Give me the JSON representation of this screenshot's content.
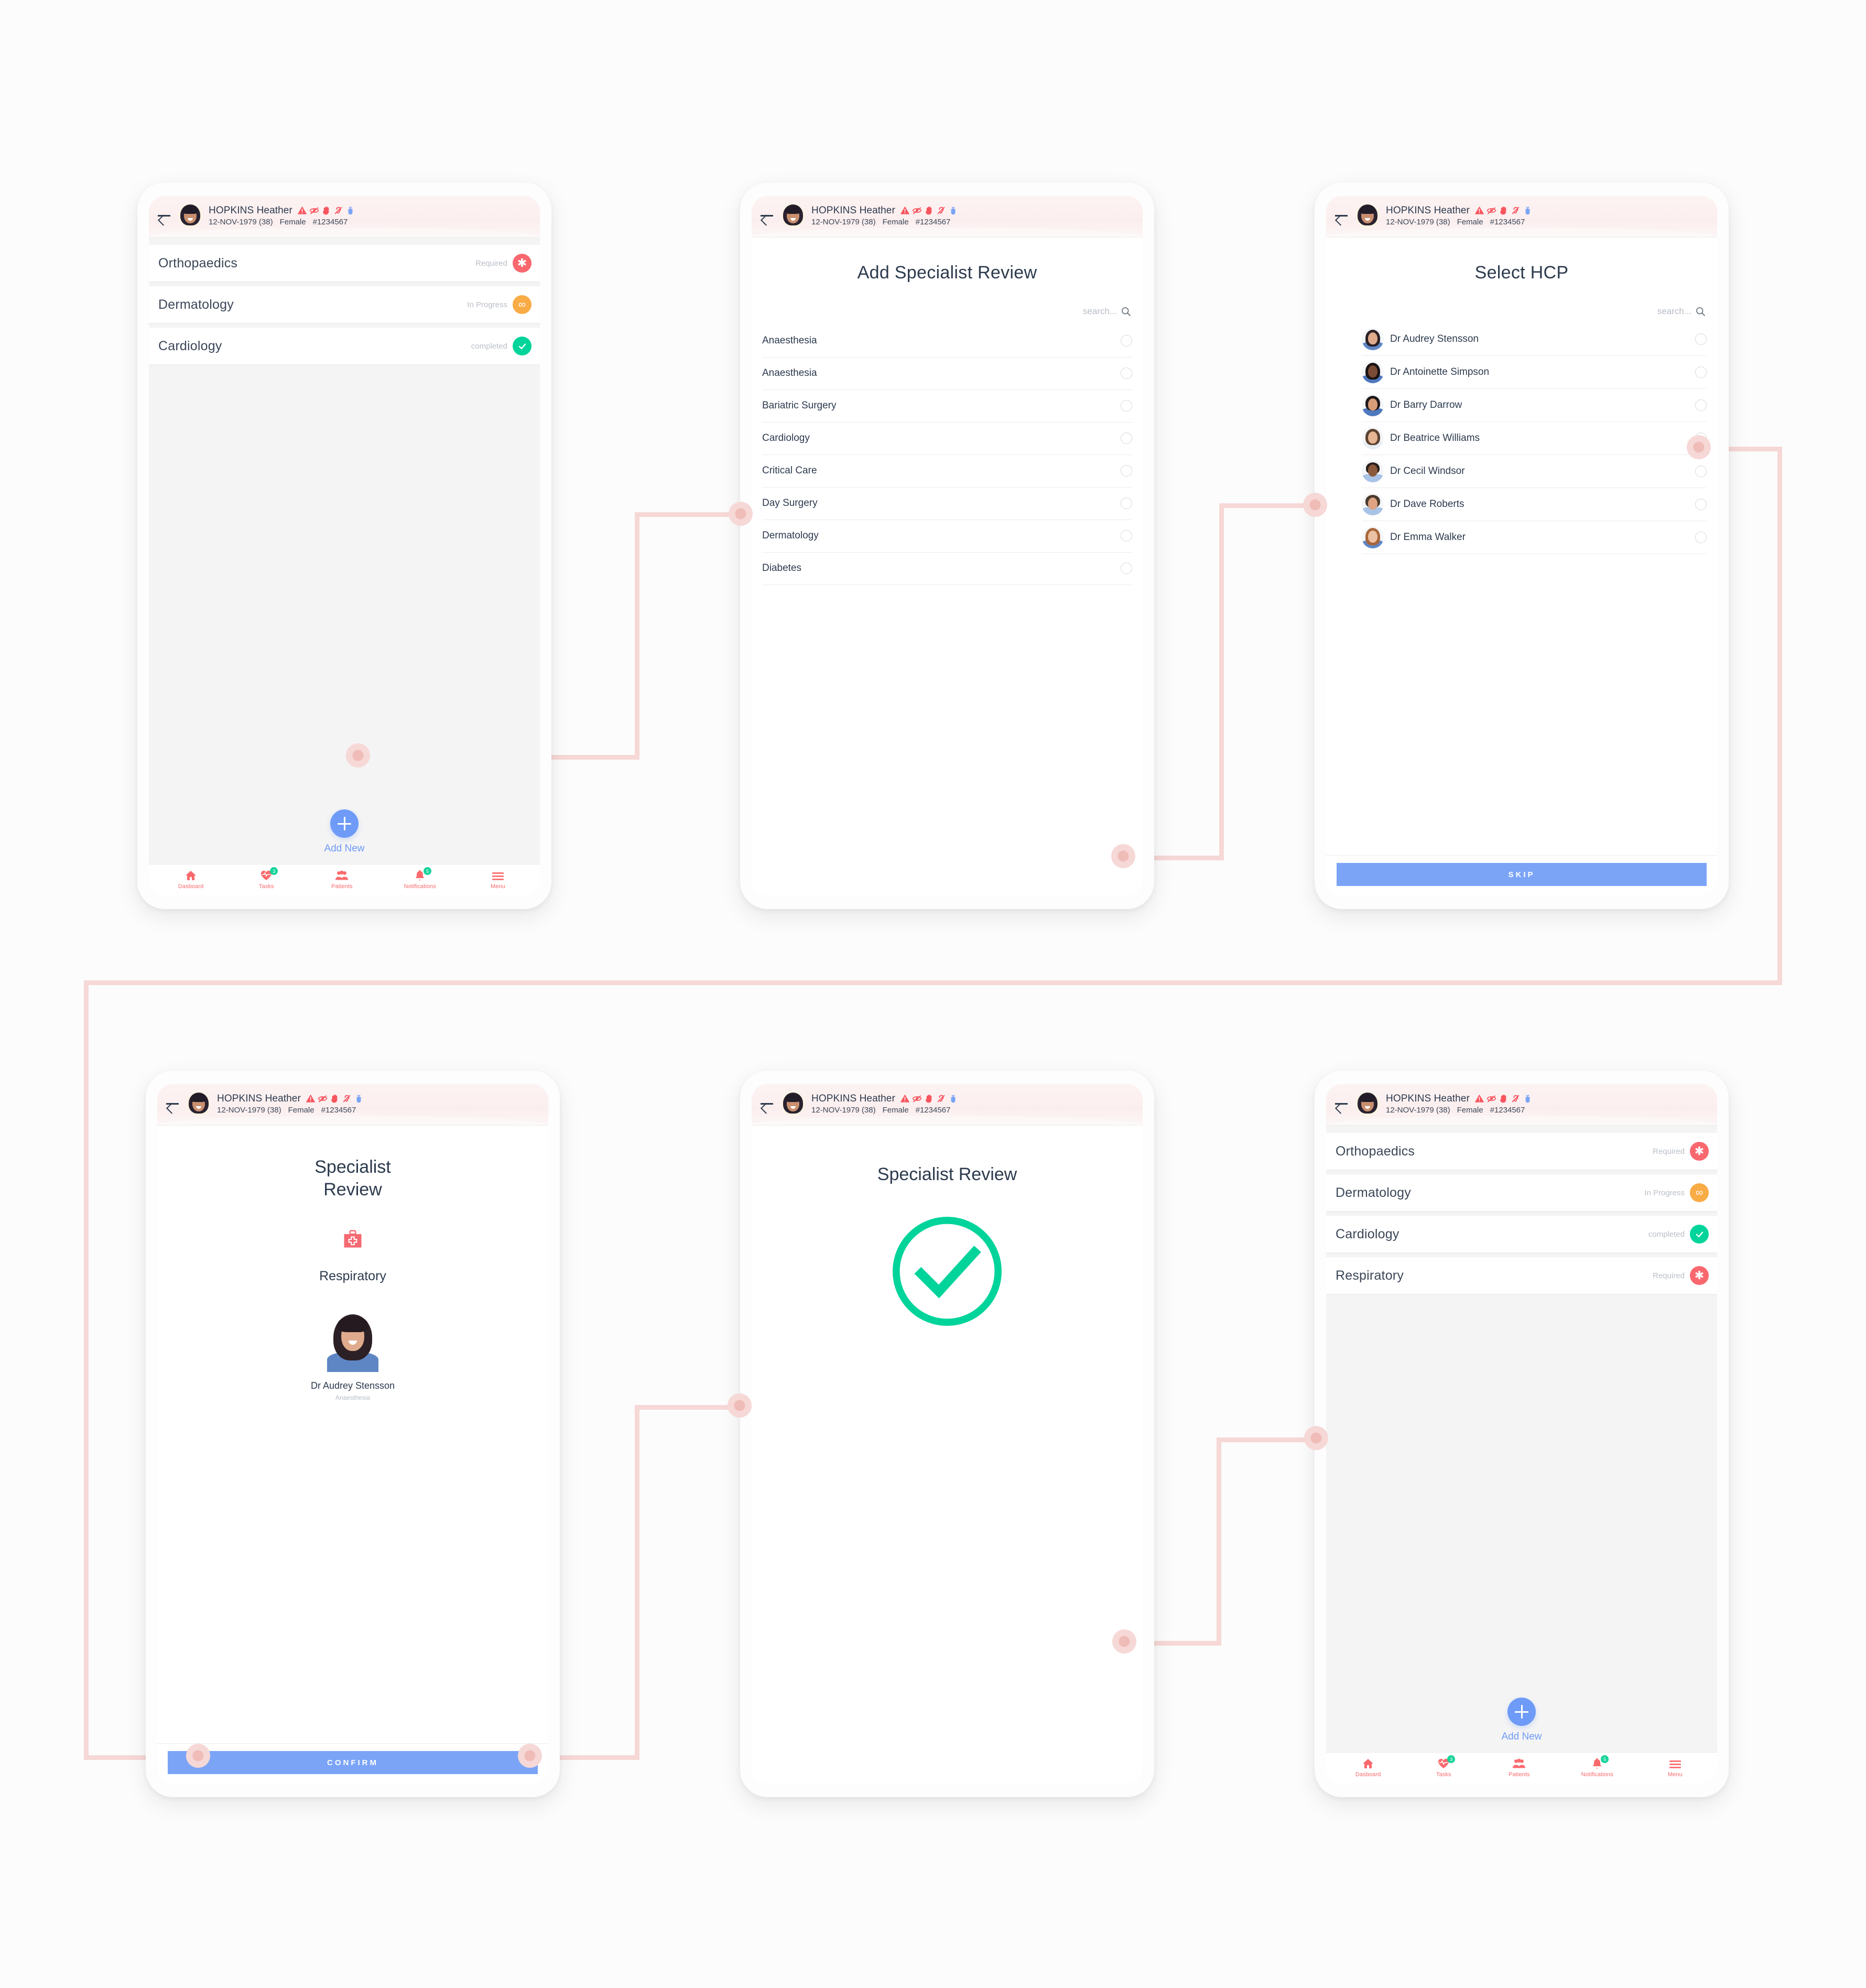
{
  "patient": {
    "name": "HOPKINS Heather",
    "dob": "12-NOV-1979 (38)",
    "sex": "Female",
    "mrn": "#1234567",
    "alert_icons": [
      "warning-triangle-icon",
      "vision-impaired-icon",
      "allergy-hand-icon",
      "hearing-impaired-icon",
      "blood-bag-icon"
    ]
  },
  "colors": {
    "required": "#f9686f",
    "in_progress": "#f9ab45",
    "completed": "#00d49a",
    "primary_blue": "#7ba4f7",
    "add_blue": "#6e9bf7",
    "nav_coral": "#fa6a6d",
    "badge_green": "#16d39a",
    "connector_pink": "#f6d8d6",
    "canvas": "#fcfcfc"
  },
  "bottom_nav": {
    "items": [
      {
        "label": "Dasboard",
        "icon": "home-icon",
        "badge": ""
      },
      {
        "label": "Tasks",
        "icon": "heart-pulse-icon",
        "badge": "3"
      },
      {
        "label": "Patients",
        "icon": "people-icon",
        "badge": ""
      },
      {
        "label": "Notifications",
        "icon": "bell-icon",
        "badge": "5"
      },
      {
        "label": "Menu",
        "icon": "hamburger-icon",
        "badge": ""
      }
    ]
  },
  "screen1": {
    "name": "specialist-review-list-before",
    "rows": [
      {
        "specialty": "Orthopaedics",
        "status": "Required",
        "badge": "asterisk",
        "badge_color": "#f9686f"
      },
      {
        "specialty": "Dermatology",
        "status": "In Progress",
        "badge": "infinity",
        "badge_color": "#f9ab45"
      },
      {
        "specialty": "Cardiology",
        "status": "completed",
        "badge": "check",
        "badge_color": "#00d49a"
      }
    ],
    "add_new_label": "Add New"
  },
  "screen2": {
    "title": "Add Specialist Review",
    "search_placeholder": "search...",
    "options": [
      "Anaesthesia",
      "Anaesthesia",
      "Bariatric Surgery",
      "Cardiology",
      "Critical Care",
      "Day Surgery",
      "Dermatology",
      "Diabetes"
    ]
  },
  "screen3": {
    "title": "Select HCP",
    "search_placeholder": "search...",
    "hcps": [
      {
        "name": "Dr Audrey Stensson",
        "hair": "#2b2026",
        "skin": "#e0ab8c",
        "scrubs": "#5f86c4"
      },
      {
        "name": "Dr Antoinette Simpson",
        "hair": "#1a1416",
        "skin": "#7a4b35",
        "scrubs": "#4f79bd"
      },
      {
        "name": "Dr Barry Darrow",
        "hair": "#20181a",
        "skin": "#d79c78",
        "scrubs": "#4f79bd"
      },
      {
        "name": "Dr Beatrice Williams",
        "hair": "#5c4230",
        "skin": "#e6b594",
        "scrubs": "#e8eef4"
      },
      {
        "name": "Dr Cecil Windsor",
        "hair": "#2b211d",
        "skin": "#8b5a3c",
        "scrubs": "#a8c3e6"
      },
      {
        "name": "Dr Dave Roberts",
        "hair": "#4a3a2c",
        "skin": "#dda382",
        "scrubs": "#a8c3e6"
      },
      {
        "name": "Dr Emma Walker",
        "hair": "#a8663a",
        "skin": "#ecc0a2",
        "scrubs": "#5f86c4"
      }
    ],
    "skip_label": "SKIP"
  },
  "screen4": {
    "title": "Specialist Review",
    "specialty": "Respiratory",
    "doctor_name": "Dr Audrey Stensson",
    "doctor_specialty": "Anaesthesia",
    "confirm_label": "CONFIRM",
    "icon": "medical-kit-icon"
  },
  "screen5": {
    "title": "Specialist Review",
    "icon": "success-check-icon"
  },
  "screen6": {
    "name": "specialist-review-list-after",
    "rows": [
      {
        "specialty": "Orthopaedics",
        "status": "Required",
        "badge": "asterisk",
        "badge_color": "#f9686f"
      },
      {
        "specialty": "Dermatology",
        "status": "In Progress",
        "badge": "infinity",
        "badge_color": "#f9ab45"
      },
      {
        "specialty": "Cardiology",
        "status": "completed",
        "badge": "check",
        "badge_color": "#00d49a"
      },
      {
        "specialty": "Respiratory",
        "status": "Required",
        "badge": "asterisk",
        "badge_color": "#f9686f"
      }
    ],
    "add_new_label": "Add New"
  }
}
